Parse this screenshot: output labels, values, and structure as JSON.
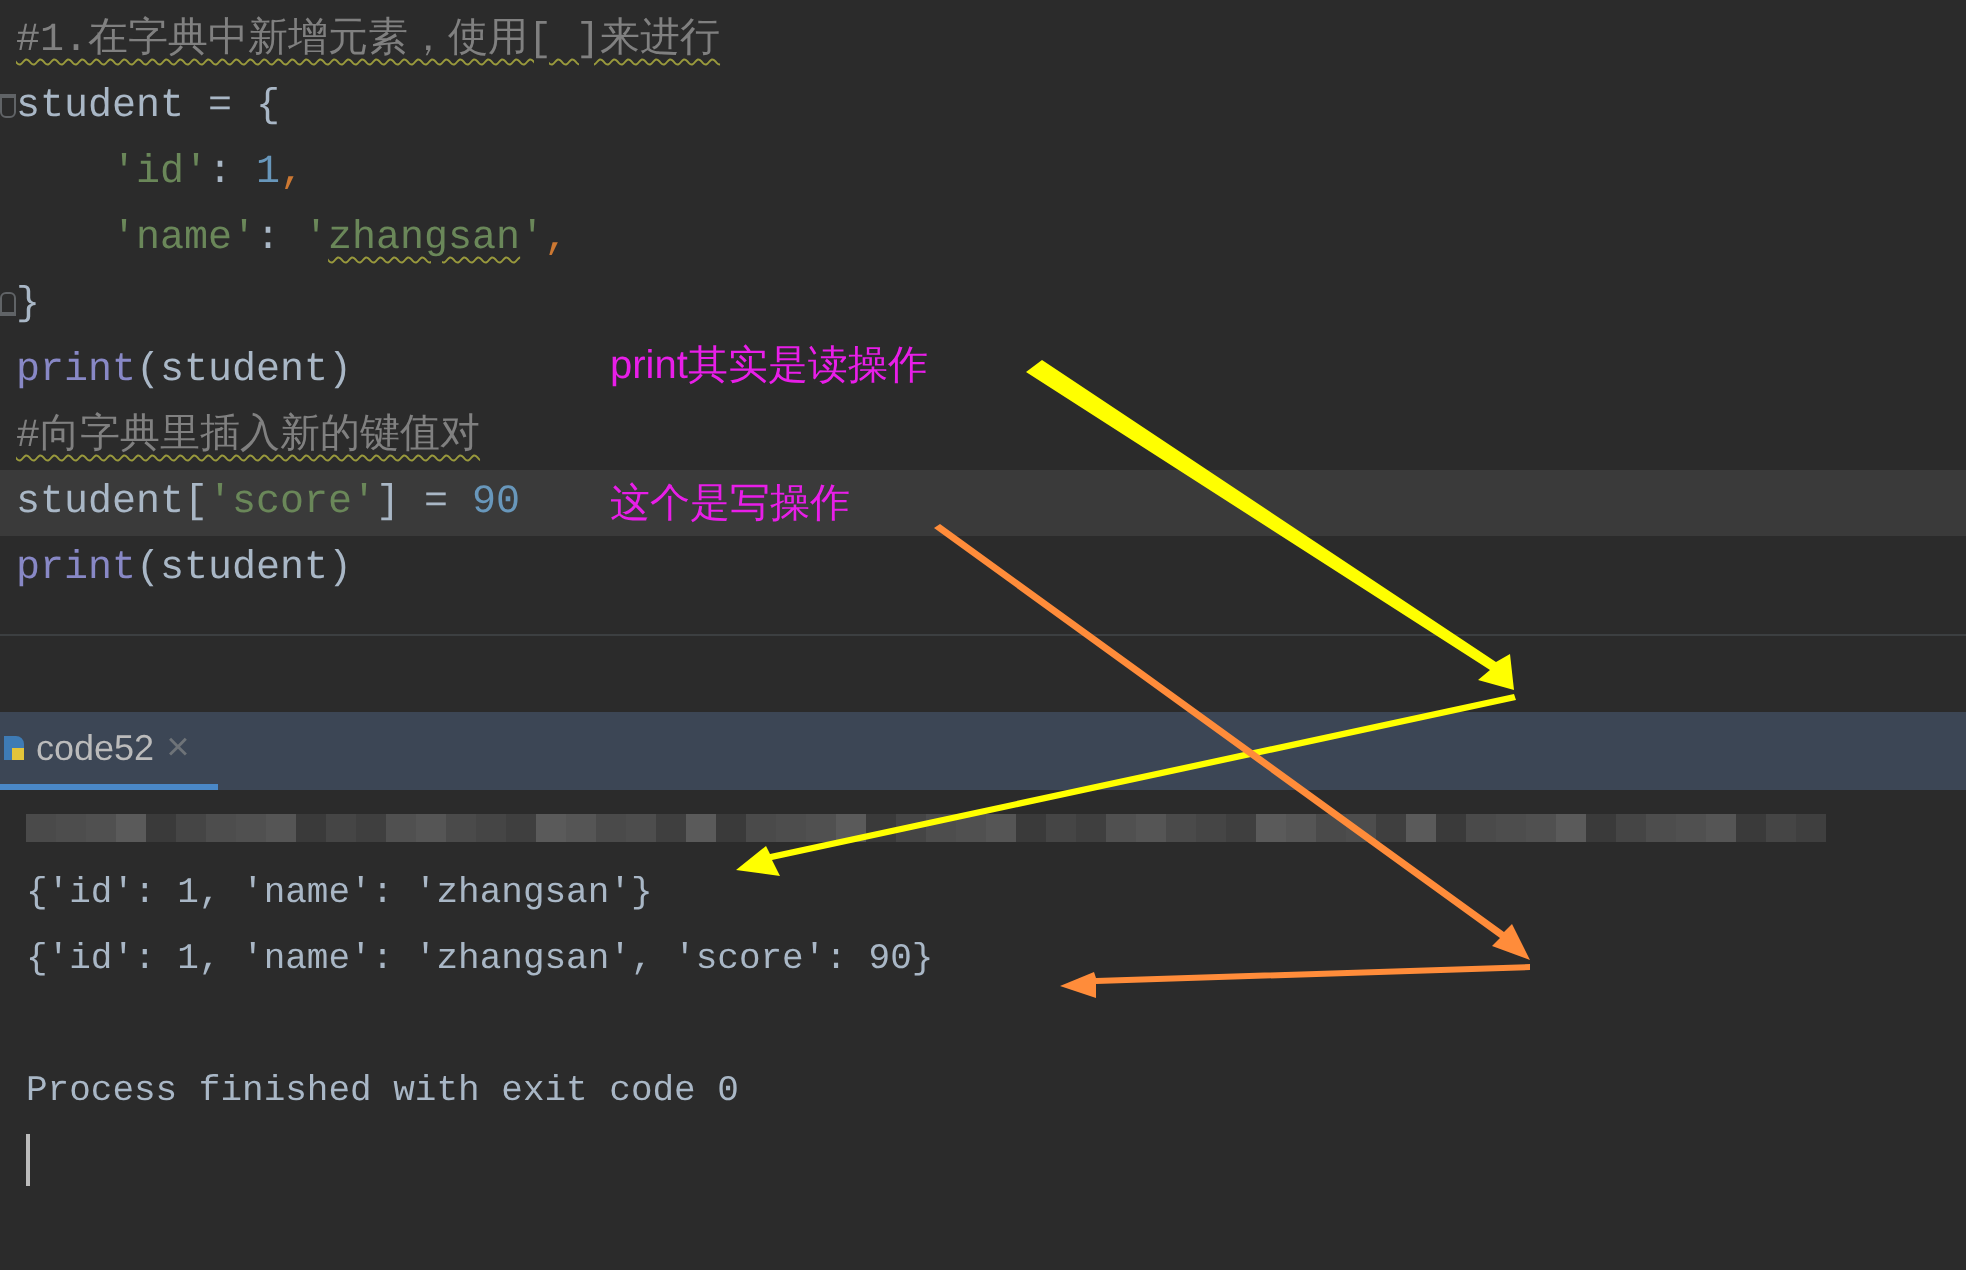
{
  "editor": {
    "lines": [
      {
        "tokens": [
          {
            "kind": "comment",
            "text": "#1.在字典中新增元素，使用[ ]来进行",
            "squiggle": true
          }
        ]
      },
      {
        "fold_open": true,
        "tokens": [
          {
            "kind": "plain",
            "text": "student = {"
          }
        ]
      },
      {
        "indented": true,
        "tokens": [
          {
            "kind": "string",
            "text": "'id'"
          },
          {
            "kind": "plain",
            "text": ": "
          },
          {
            "kind": "number",
            "text": "1"
          },
          {
            "kind": "punct",
            "text": ","
          }
        ]
      },
      {
        "indented": true,
        "tokens": [
          {
            "kind": "string",
            "text": "'name'"
          },
          {
            "kind": "plain",
            "text": ": "
          },
          {
            "kind": "string",
            "text": "'"
          },
          {
            "kind": "string",
            "text": "zhangsan",
            "squiggle": true
          },
          {
            "kind": "string",
            "text": "'"
          },
          {
            "kind": "punct",
            "text": ","
          }
        ]
      },
      {
        "fold_close": true,
        "tokens": [
          {
            "kind": "plain",
            "text": "}"
          }
        ]
      },
      {
        "tokens": [
          {
            "kind": "keyword",
            "text": "print"
          },
          {
            "kind": "plain",
            "text": "(student)"
          }
        ]
      },
      {
        "tokens": [
          {
            "kind": "comment",
            "text": "#向字典里插入新的键值对",
            "squiggle": true
          }
        ]
      },
      {
        "current": true,
        "tokens": [
          {
            "kind": "plain",
            "text": "student["
          },
          {
            "kind": "string",
            "text": "'score'"
          },
          {
            "kind": "plain",
            "text": "] = "
          },
          {
            "kind": "number",
            "text": "90"
          }
        ]
      },
      {
        "tokens": [
          {
            "kind": "keyword",
            "text": "print"
          },
          {
            "kind": "plain",
            "text": "(student)"
          }
        ]
      }
    ]
  },
  "run_tab": {
    "label": "code52",
    "selected": true,
    "close": "×"
  },
  "console": {
    "lines": [
      {
        "text": "{'id': 1, 'name': 'zhangsan'}"
      },
      {
        "text": "{'id': 1, 'name': 'zhangsan', 'score': 90}"
      },
      {
        "text": "Process finished with exit code 0",
        "gap_before": true
      }
    ]
  },
  "annotations": [
    {
      "text": "print其实是读操作",
      "color": "#e81ee8"
    },
    {
      "text": "这个是写操作",
      "color": "#e81ee8"
    }
  ]
}
